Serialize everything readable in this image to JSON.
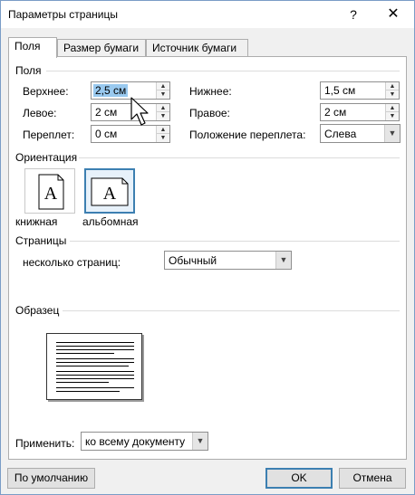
{
  "window": {
    "title": "Параметры страницы",
    "help": "?",
    "close": "✕"
  },
  "tabs": [
    {
      "label": "Поля",
      "active": true
    },
    {
      "label": "Размер бумаги",
      "active": false
    },
    {
      "label": "Источник бумаги",
      "active": false
    }
  ],
  "margins": {
    "section": "Поля",
    "top_label": "Верхнее:",
    "top_value": "2,5 см",
    "bottom_label": "Нижнее:",
    "bottom_value": "1,5 см",
    "left_label": "Левое:",
    "left_value": "2 см",
    "right_label": "Правое:",
    "right_value": "2 см",
    "gutter_label": "Переплет:",
    "gutter_value": "0 см",
    "gutter_pos_label": "Положение переплета:",
    "gutter_pos_value": "Слева"
  },
  "orientation": {
    "section": "Ориентация",
    "portrait_label": "книжная",
    "landscape_label": "альбомная",
    "icon_letter": "A",
    "selected": "landscape"
  },
  "pages": {
    "section": "Страницы",
    "multiple_label": "несколько страниц:",
    "multiple_value": "Обычный"
  },
  "preview": {
    "section": "Образец"
  },
  "apply": {
    "label": "Применить:",
    "value": "ко всему документу"
  },
  "buttons": {
    "default": "По умолчанию",
    "ok": "OK",
    "cancel": "Отмена"
  },
  "icons": {
    "spin_up": "▲",
    "spin_down": "▼",
    "dropdown": "▼"
  },
  "colors": {
    "accent": "#3c7fb1",
    "selection": "#99c9ef"
  }
}
